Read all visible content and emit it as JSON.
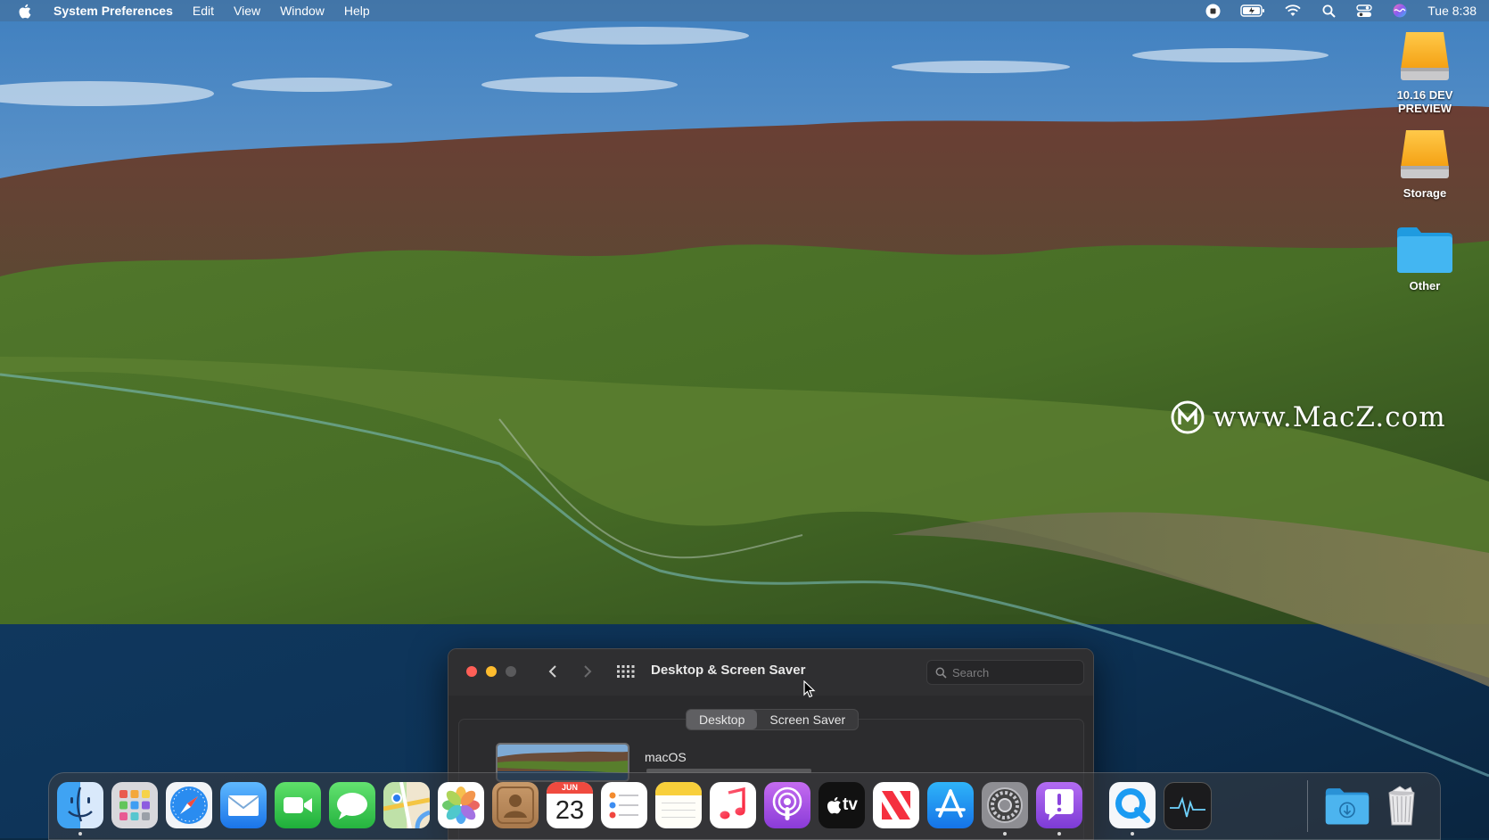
{
  "menubar": {
    "app_name": "System Preferences",
    "menus": [
      "Edit",
      "View",
      "Window",
      "Help"
    ],
    "clock": "Tue 8:38",
    "status_icons": [
      "screen-record-icon",
      "battery-icon",
      "wifi-icon",
      "spotlight-icon",
      "control-center-icon",
      "siri-icon"
    ]
  },
  "desktop": {
    "icons": [
      {
        "label": "10.16 DEV PREVIEW",
        "icon": "drive-icon"
      },
      {
        "label": "Storage",
        "icon": "drive-icon"
      },
      {
        "label": "Other",
        "icon": "folder-icon"
      }
    ]
  },
  "watermark": {
    "text": "www.MacZ.com",
    "logo": "M"
  },
  "window": {
    "title": "Desktop & Screen Saver",
    "search_placeholder": "Search",
    "tabs": [
      {
        "label": "Desktop",
        "active": true
      },
      {
        "label": "Screen Saver",
        "active": false
      }
    ],
    "selected_picture": "macOS"
  },
  "dock": {
    "apps": [
      {
        "name": "Finder",
        "icon": "finder-icon",
        "running": true
      },
      {
        "name": "Launchpad",
        "icon": "launchpad-icon",
        "running": false
      },
      {
        "name": "Safari",
        "icon": "safari-icon",
        "running": false
      },
      {
        "name": "Mail",
        "icon": "mail-icon",
        "running": false
      },
      {
        "name": "FaceTime",
        "icon": "facetime-icon",
        "running": false
      },
      {
        "name": "Messages",
        "icon": "messages-icon",
        "running": false
      },
      {
        "name": "Maps",
        "icon": "maps-icon",
        "running": false
      },
      {
        "name": "Photos",
        "icon": "photos-icon",
        "running": false
      },
      {
        "name": "Contacts",
        "icon": "contacts-icon",
        "running": false
      },
      {
        "name": "Calendar",
        "icon": "calendar-icon",
        "running": false
      },
      {
        "name": "Reminders",
        "icon": "reminders-icon",
        "running": false
      },
      {
        "name": "Notes",
        "icon": "notes-icon",
        "running": false
      },
      {
        "name": "Music",
        "icon": "music-icon",
        "running": false
      },
      {
        "name": "Podcasts",
        "icon": "podcasts-icon",
        "running": false
      },
      {
        "name": "TV",
        "icon": "tv-icon",
        "running": false
      },
      {
        "name": "News",
        "icon": "news-icon",
        "running": false
      },
      {
        "name": "App Store",
        "icon": "app-store-icon",
        "running": false
      },
      {
        "name": "System Preferences",
        "icon": "system-preferences-icon",
        "running": true
      },
      {
        "name": "Feedback Assistant",
        "icon": "feedback-icon",
        "running": true
      },
      {
        "name": "QuickTime Player",
        "icon": "quicktime-icon",
        "running": true
      },
      {
        "name": "Activity Monitor",
        "icon": "activity-monitor-icon",
        "running": false
      },
      {
        "name": "Downloads",
        "icon": "downloads-folder-icon",
        "running": false
      },
      {
        "name": "Trash",
        "icon": "trash-icon",
        "running": false
      }
    ],
    "calendar_month": "JUN",
    "calendar_day": "23",
    "tv_label": "tv"
  },
  "colors": {
    "close": "#ff5f57",
    "minimize": "#febc2e",
    "zoom": "#5a5a5c",
    "window_bg": "#2a2a2c"
  }
}
